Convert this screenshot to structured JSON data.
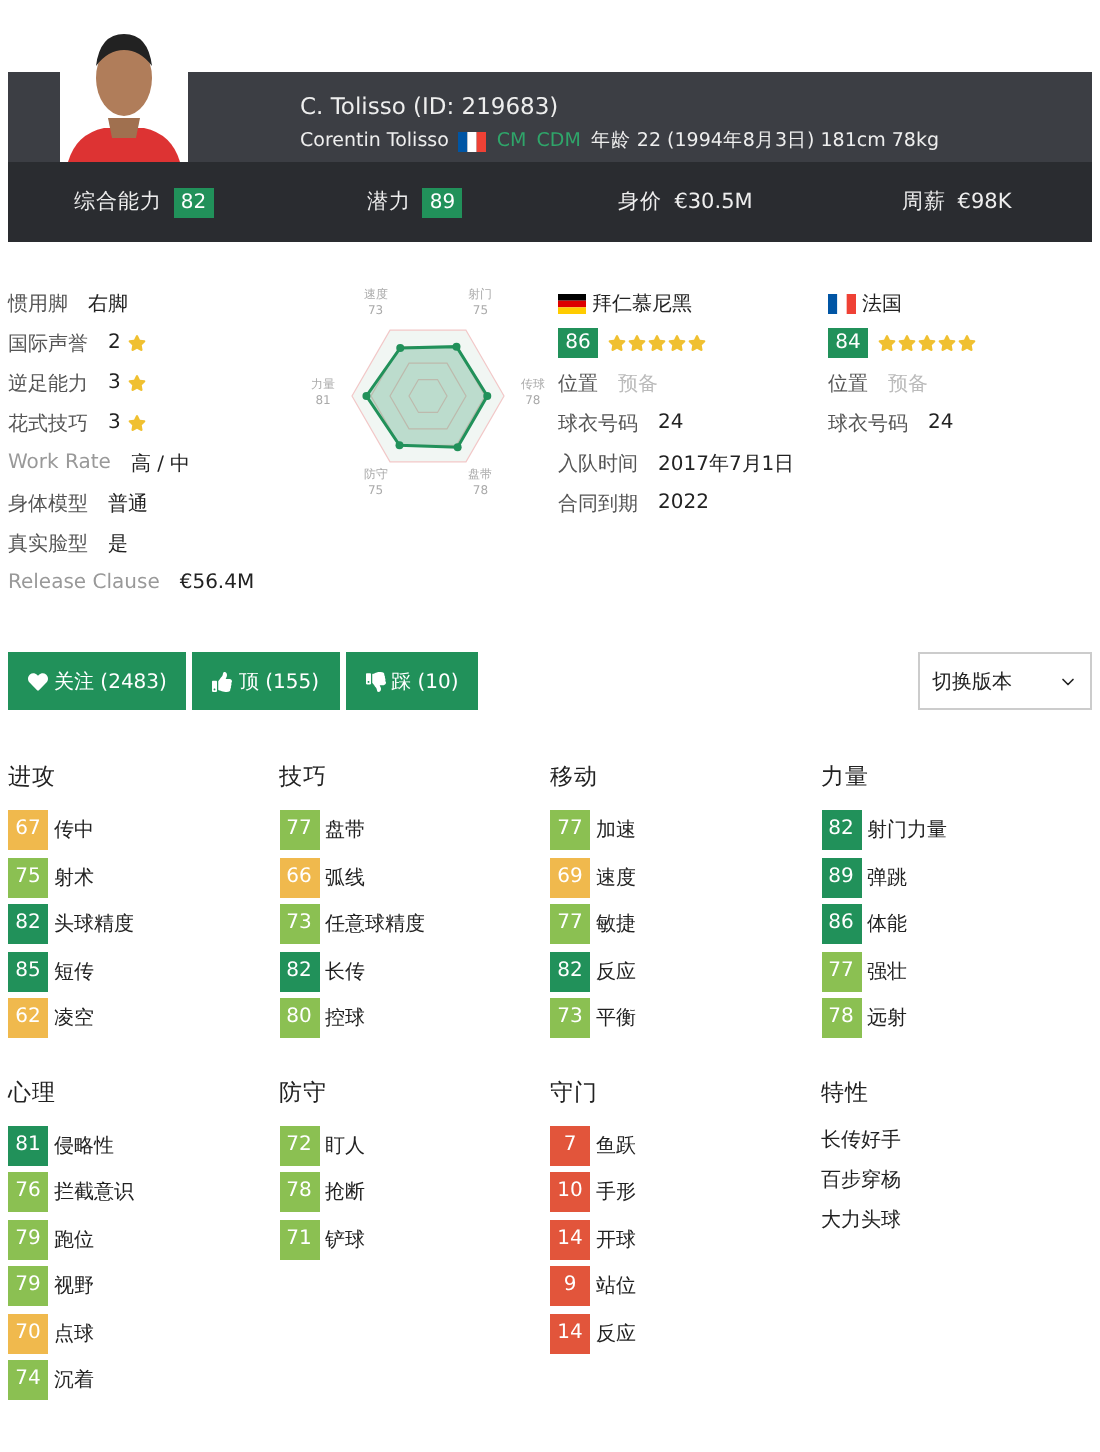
{
  "header": {
    "title": "C. Tolisso (ID: 219683)",
    "full_name": "Corentin Tolisso",
    "positions": [
      "CM",
      "CDM"
    ],
    "details": "年龄 22 (1994年8月3日) 181cm 78kg"
  },
  "summary": [
    {
      "label": "综合能力",
      "value": "82",
      "kind": "badge"
    },
    {
      "label": "潜力",
      "value": "89",
      "kind": "badge"
    },
    {
      "label": "身价",
      "value": "€30.5M",
      "kind": "text"
    },
    {
      "label": "周薪",
      "value": "€98K",
      "kind": "text"
    }
  ],
  "profile": [
    {
      "label": "惯用脚",
      "value": "右脚",
      "kind": "text"
    },
    {
      "label": "国际声誉",
      "value": "2",
      "kind": "stars"
    },
    {
      "label": "逆足能力",
      "value": "3",
      "kind": "stars"
    },
    {
      "label": "花式技巧",
      "value": "3",
      "kind": "stars"
    },
    {
      "label": "Work Rate",
      "value": "高 / 中",
      "kind": "text"
    },
    {
      "label": "身体模型",
      "value": "普通",
      "kind": "text"
    },
    {
      "label": "真实脸型",
      "value": "是",
      "kind": "text"
    },
    {
      "label": "Release Clause",
      "value": "€56.4M",
      "kind": "text"
    }
  ],
  "radar": [
    {
      "label": "射门",
      "value": "75"
    },
    {
      "label": "传球",
      "value": "78"
    },
    {
      "label": "盘带",
      "value": "78"
    },
    {
      "label": "防守",
      "value": "75"
    },
    {
      "label": "力量",
      "value": "81"
    },
    {
      "label": "速度",
      "value": "73"
    }
  ],
  "teams": [
    {
      "name": "拜仁慕尼黑",
      "kind": "germany",
      "rating": "86",
      "stars": 5,
      "fields": [
        {
          "label": "位置",
          "value": "预备",
          "muted": true
        },
        {
          "label": "球衣号码",
          "value": "24",
          "muted": false
        },
        {
          "label": "入队时间",
          "value": "2017年7月1日",
          "muted": false
        },
        {
          "label": "合同到期",
          "value": "2022",
          "muted": false
        }
      ]
    },
    {
      "name": "法国",
      "kind": "france",
      "rating": "84",
      "stars": 5,
      "fields": [
        {
          "label": "位置",
          "value": "预备",
          "muted": true
        },
        {
          "label": "球衣号码",
          "value": "24",
          "muted": false
        }
      ]
    }
  ],
  "actions": [
    {
      "label": "关注 (2483)",
      "kind": "heart"
    },
    {
      "label": "顶 (155)",
      "kind": "thumbs-up"
    },
    {
      "label": "踩 (10)",
      "kind": "thumbs-down"
    }
  ],
  "version_select": {
    "value": "切换版本"
  },
  "groups": [
    {
      "title": "进攻",
      "stats": [
        {
          "value": "67",
          "name": "传中",
          "color": "#f0b94d"
        },
        {
          "value": "75",
          "name": "射术",
          "color": "#8bc052"
        },
        {
          "value": "82",
          "name": "头球精度",
          "color": "#21915a"
        },
        {
          "value": "85",
          "name": "短传",
          "color": "#21915a"
        },
        {
          "value": "62",
          "name": "凌空",
          "color": "#f0b94d"
        }
      ]
    },
    {
      "title": "技巧",
      "stats": [
        {
          "value": "77",
          "name": "盘带",
          "color": "#8bc052"
        },
        {
          "value": "66",
          "name": "弧线",
          "color": "#f0b94d"
        },
        {
          "value": "73",
          "name": "任意球精度",
          "color": "#8bc052"
        },
        {
          "value": "82",
          "name": "长传",
          "color": "#21915a"
        },
        {
          "value": "80",
          "name": "控球",
          "color": "#8bc052"
        }
      ]
    },
    {
      "title": "移动",
      "stats": [
        {
          "value": "77",
          "name": "加速",
          "color": "#8bc052"
        },
        {
          "value": "69",
          "name": "速度",
          "color": "#f0b94d"
        },
        {
          "value": "77",
          "name": "敏捷",
          "color": "#8bc052"
        },
        {
          "value": "82",
          "name": "反应",
          "color": "#21915a"
        },
        {
          "value": "73",
          "name": "平衡",
          "color": "#8bc052"
        }
      ]
    },
    {
      "title": "力量",
      "stats": [
        {
          "value": "82",
          "name": "射门力量",
          "color": "#21915a"
        },
        {
          "value": "89",
          "name": "弹跳",
          "color": "#21915a"
        },
        {
          "value": "86",
          "name": "体能",
          "color": "#21915a"
        },
        {
          "value": "77",
          "name": "强壮",
          "color": "#8bc052"
        },
        {
          "value": "78",
          "name": "远射",
          "color": "#8bc052"
        }
      ]
    },
    {
      "title": "心理",
      "stats": [
        {
          "value": "81",
          "name": "侵略性",
          "color": "#21915a"
        },
        {
          "value": "76",
          "name": "拦截意识",
          "color": "#8bc052"
        },
        {
          "value": "79",
          "name": "跑位",
          "color": "#8bc052"
        },
        {
          "value": "79",
          "name": "视野",
          "color": "#8bc052"
        },
        {
          "value": "70",
          "name": "点球",
          "color": "#f0b94d"
        },
        {
          "value": "74",
          "name": "沉着",
          "color": "#8bc052"
        }
      ]
    },
    {
      "title": "防守",
      "stats": [
        {
          "value": "72",
          "name": "盯人",
          "color": "#8bc052"
        },
        {
          "value": "78",
          "name": "抢断",
          "color": "#8bc052"
        },
        {
          "value": "71",
          "name": "铲球",
          "color": "#8bc052"
        }
      ]
    },
    {
      "title": "守门",
      "stats": [
        {
          "value": "7",
          "name": "鱼跃",
          "color": "#e2553b"
        },
        {
          "value": "10",
          "name": "手形",
          "color": "#e2553b"
        },
        {
          "value": "14",
          "name": "开球",
          "color": "#e2553b"
        },
        {
          "value": "9",
          "name": "站位",
          "color": "#e2553b"
        },
        {
          "value": "14",
          "name": "反应",
          "color": "#e2553b"
        }
      ]
    },
    {
      "title": "特性",
      "traits": [
        "长传好手",
        "百步穿杨",
        "大力头球"
      ]
    }
  ]
}
